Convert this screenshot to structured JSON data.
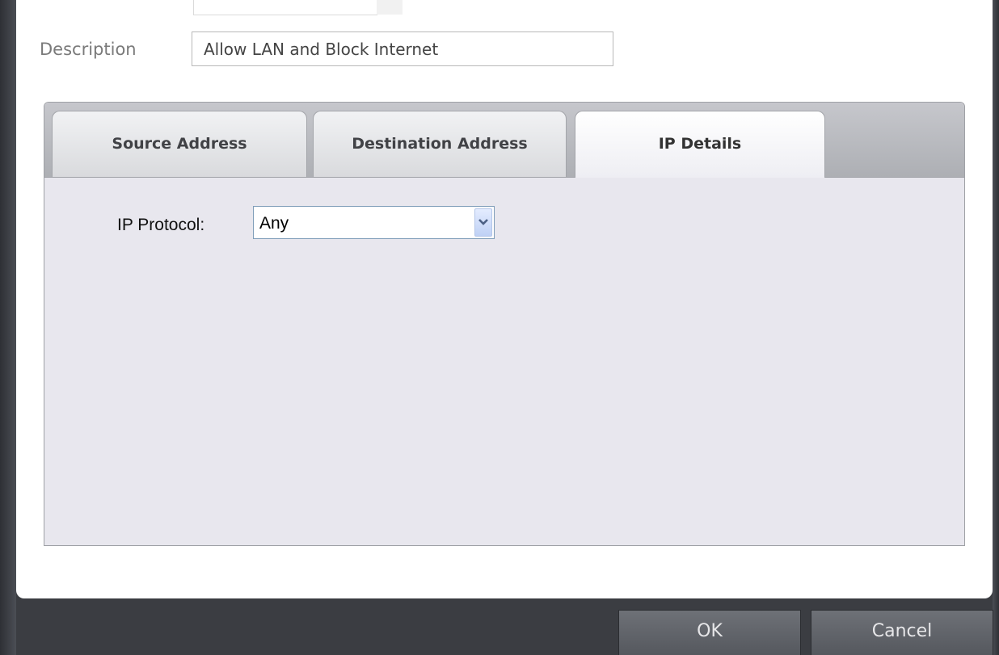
{
  "form": {
    "description_label": "Description",
    "description_value": "Allow LAN and Block Internet"
  },
  "tabs": [
    {
      "label": "Source Address",
      "active": false
    },
    {
      "label": "Destination Address",
      "active": false
    },
    {
      "label": "IP Details",
      "active": true
    }
  ],
  "ip_details": {
    "protocol_label": "IP Protocol:",
    "protocol_value": "Any"
  },
  "buttons": {
    "ok": "OK",
    "cancel": "Cancel"
  },
  "colors": {
    "frame": "#3b3d42",
    "tab_body": "#e8e7ee",
    "tab_strip": "#b8babf"
  }
}
